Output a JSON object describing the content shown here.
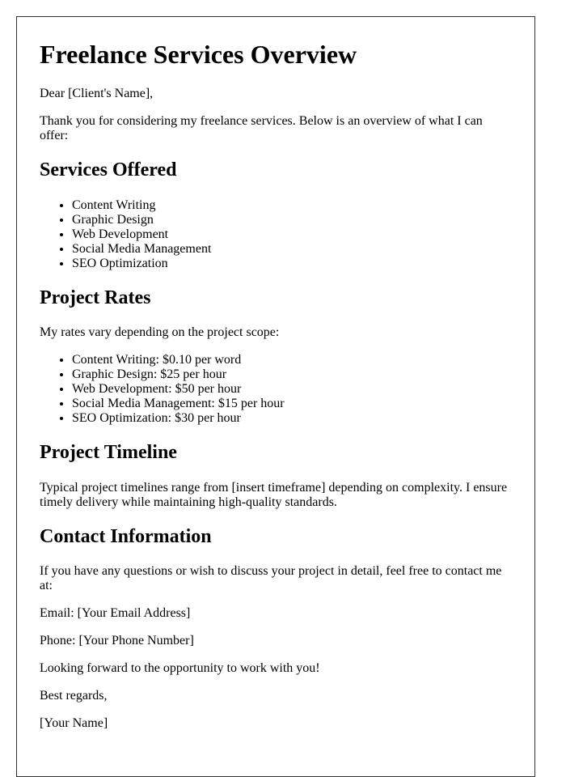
{
  "document": {
    "title": "Freelance Services Overview",
    "greeting": "Dear [Client's Name],",
    "intro": "Thank you for considering my freelance services. Below is an overview of what I can offer:",
    "services": {
      "heading": "Services Offered",
      "items": [
        "Content Writing",
        "Graphic Design",
        "Web Development",
        "Social Media Management",
        "SEO Optimization"
      ]
    },
    "rates": {
      "heading": "Project Rates",
      "intro": "My rates vary depending on the project scope:",
      "items": [
        "Content Writing: $0.10 per word",
        "Graphic Design: $25 per hour",
        "Web Development: $50 per hour",
        "Social Media Management: $15 per hour",
        "SEO Optimization: $30 per hour"
      ]
    },
    "timeline": {
      "heading": "Project Timeline",
      "text": "Typical project timelines range from [insert timeframe] depending on complexity. I ensure timely delivery while maintaining high-quality standards."
    },
    "contact": {
      "heading": "Contact Information",
      "text": "If you have any questions or wish to discuss your project in detail, feel free to contact me at:",
      "email": "Email: [Your Email Address]",
      "phone": "Phone: [Your Phone Number]"
    },
    "closing": "Looking forward to the opportunity to work with you!",
    "sign_off": "Best regards,",
    "signature": "[Your Name]"
  }
}
